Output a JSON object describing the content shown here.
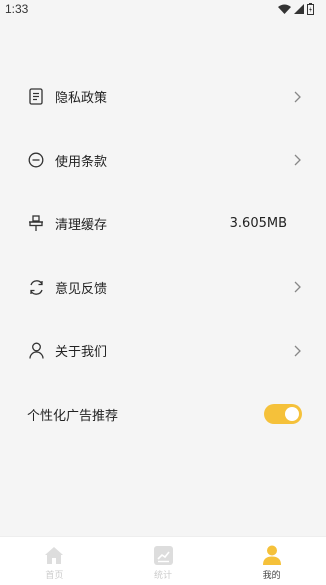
{
  "status_bar": {
    "time": "1:33"
  },
  "menu": {
    "items": [
      {
        "label": "隐私政策",
        "icon": "document-icon",
        "value": "",
        "chevron": true
      },
      {
        "label": "使用条款",
        "icon": "terms-icon",
        "value": "",
        "chevron": true
      },
      {
        "label": "清理缓存",
        "icon": "clean-icon",
        "value": "3.605MB",
        "chevron": false
      },
      {
        "label": "意见反馈",
        "icon": "refresh-feedback-icon",
        "value": "",
        "chevron": true
      },
      {
        "label": "关于我们",
        "icon": "person-icon",
        "value": "",
        "chevron": true
      }
    ],
    "ad_toggle": {
      "label": "个性化广告推荐",
      "on": true
    }
  },
  "tabbar": {
    "tabs": [
      {
        "label": "首页",
        "icon": "home-icon",
        "active": false
      },
      {
        "label": "统计",
        "icon": "chart-icon",
        "active": false
      },
      {
        "label": "我的",
        "icon": "user-icon",
        "active": true
      }
    ]
  },
  "colors": {
    "accent": "#f5c13a",
    "background": "#f5f5f5",
    "inactive_tab": "#cccccc"
  }
}
